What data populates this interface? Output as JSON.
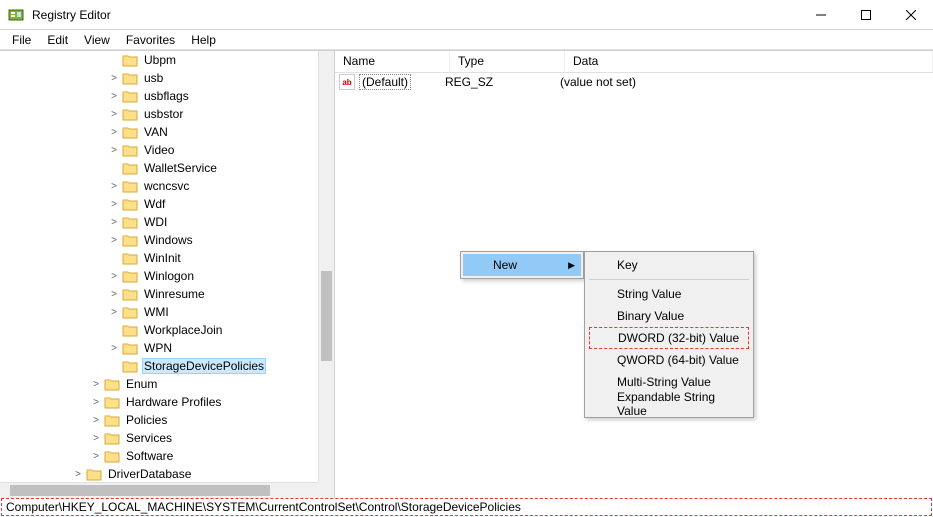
{
  "window": {
    "title": "Registry Editor"
  },
  "menubar": [
    "File",
    "Edit",
    "View",
    "Favorites",
    "Help"
  ],
  "tree": {
    "indent_base": 108,
    "items": [
      {
        "label": "Ubpm",
        "expander": ""
      },
      {
        "label": "usb",
        "expander": ">"
      },
      {
        "label": "usbflags",
        "expander": ">"
      },
      {
        "label": "usbstor",
        "expander": ">"
      },
      {
        "label": "VAN",
        "expander": ">"
      },
      {
        "label": "Video",
        "expander": ">"
      },
      {
        "label": "WalletService",
        "expander": ""
      },
      {
        "label": "wcncsvc",
        "expander": ">"
      },
      {
        "label": "Wdf",
        "expander": ">"
      },
      {
        "label": "WDI",
        "expander": ">"
      },
      {
        "label": "Windows",
        "expander": ">"
      },
      {
        "label": "WinInit",
        "expander": ""
      },
      {
        "label": "Winlogon",
        "expander": ">"
      },
      {
        "label": "Winresume",
        "expander": ">"
      },
      {
        "label": "WMI",
        "expander": ">"
      },
      {
        "label": "WorkplaceJoin",
        "expander": ""
      },
      {
        "label": "WPN",
        "expander": ">"
      },
      {
        "label": "StorageDevicePolicies",
        "expander": "",
        "selected": true
      }
    ],
    "siblings_indent": 90,
    "siblings": [
      {
        "label": "Enum",
        "expander": ">"
      },
      {
        "label": "Hardware Profiles",
        "expander": ">"
      },
      {
        "label": "Policies",
        "expander": ">"
      },
      {
        "label": "Services",
        "expander": ">"
      },
      {
        "label": "Software",
        "expander": ">"
      }
    ],
    "tail_indent": 72,
    "tail": [
      {
        "label": "DriverDatabase",
        "expander": ">"
      }
    ]
  },
  "list": {
    "columns": {
      "name": "Name",
      "type": "Type",
      "data": "Data"
    },
    "rows": [
      {
        "icon": "ab",
        "name": "(Default)",
        "type": "REG_SZ",
        "data": "(value not set)"
      }
    ]
  },
  "context_menu": {
    "parent_label": "New",
    "submenu": [
      {
        "label": "Key",
        "sep_after": true
      },
      {
        "label": "String Value"
      },
      {
        "label": "Binary Value"
      },
      {
        "label": "DWORD (32-bit) Value",
        "highlight": true
      },
      {
        "label": "QWORD (64-bit) Value"
      },
      {
        "label": "Multi-String Value"
      },
      {
        "label": "Expandable String Value"
      }
    ]
  },
  "statusbar": "Computer\\HKEY_LOCAL_MACHINE\\SYSTEM\\CurrentControlSet\\Control\\StorageDevicePolicies"
}
